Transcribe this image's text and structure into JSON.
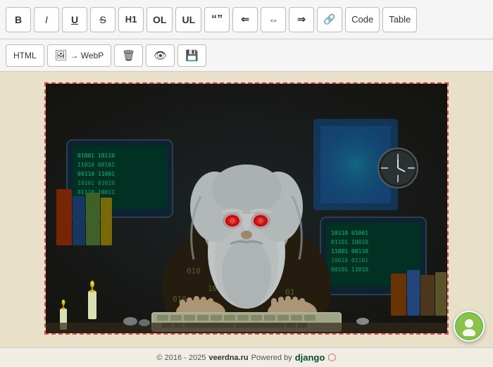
{
  "toolbar": {
    "bold_label": "B",
    "italic_label": "I",
    "underline_label": "U",
    "strikethrough_label": "S",
    "h1_label": "H1",
    "ol_label": "OL",
    "ul_label": "UL",
    "quote_label": "“”",
    "align_left_label": "⇐",
    "align_center_label": "⇔",
    "align_right_label": "⇒",
    "link_label": "🔗",
    "code_label": "Code",
    "table_label": "Table"
  },
  "toolbar2": {
    "html_label": "HTML",
    "webp_label": "→ WebP",
    "delete_label": "🗑",
    "preview_label": "👁",
    "save_label": "💾"
  },
  "footer": {
    "copyright": "© 2016 - 2025",
    "site": "veerdna.ru",
    "powered_by": "Powered by",
    "django": "django",
    "logo": "⚡"
  },
  "image": {
    "alt": "Wizard programmer at computer",
    "description": "An old wizard with white beard and glowing red eyes sitting at a keyboard surrounded by old computers, books, and candles in a dark stone room"
  }
}
